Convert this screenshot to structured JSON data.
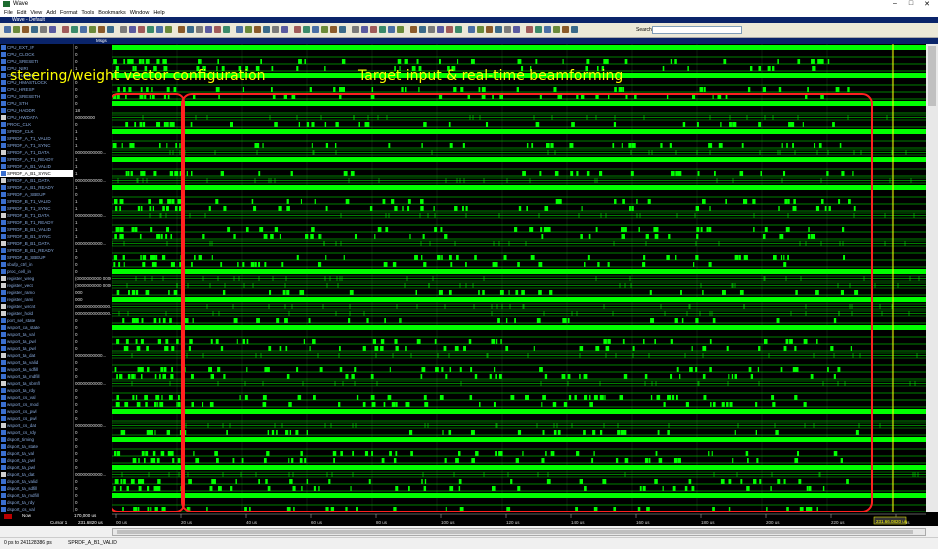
{
  "window": {
    "title": "Wave"
  },
  "menu": [
    "File",
    "Edit",
    "View",
    "Add",
    "Format",
    "Tools",
    "Bookmarks",
    "Window",
    "Help"
  ],
  "subwindow": {
    "title": "Wave - Default"
  },
  "toolbar": {
    "search_label": "Search:",
    "search_value": ""
  },
  "panel_header": {
    "msgs_label": "Msgs"
  },
  "annotations": {
    "left": "steering/weight vector configuration",
    "right": "Target input & real-time beamforming"
  },
  "signals": [
    {
      "name": "CPU_EXT_IF",
      "value": "0"
    },
    {
      "name": "CPU_CLOCK",
      "value": "0"
    },
    {
      "name": "CPU_SRESETI",
      "value": "0"
    },
    {
      "name": "CPU_NIRI",
      "value": "1"
    },
    {
      "name": "CPU_HADDR",
      "value": ""
    },
    {
      "name": "CPU_HMASTLOCK",
      "value": "0"
    },
    {
      "name": "CPU_HRESP",
      "value": "0"
    },
    {
      "name": "CPU_SRESETH",
      "value": "0"
    },
    {
      "name": "CPU_STH",
      "value": "0"
    },
    {
      "name": "CPU_HADDR",
      "value": "18"
    },
    {
      "name": "CPU_HWDATA",
      "value": "00000000"
    },
    {
      "name": "PROC_CLK",
      "value": "0"
    },
    {
      "name": "SPRDF_CLK",
      "value": "1"
    },
    {
      "name": "SPRDF_A_T1_VALID",
      "value": "1"
    },
    {
      "name": "SPRDF_A_T1_SYNC",
      "value": "1"
    },
    {
      "name": "SPRDF_A_T1_DATA",
      "value": "00000000000..."
    },
    {
      "name": "SPRDF_A_T1_READY",
      "value": "1"
    },
    {
      "name": "SPRDF_A_B1_VALID",
      "value": "1"
    },
    {
      "name": "SPRDF_A_B1_SYNC",
      "value": "1"
    },
    {
      "name": "SPRDF_A_B1_DATA",
      "value": "00000000000..."
    },
    {
      "name": "SPRDF_A_B1_READY",
      "value": "1"
    },
    {
      "name": "SPRDF_A_SBEUP",
      "value": "0"
    },
    {
      "name": "SPRDF_B_T1_VALID",
      "value": "1"
    },
    {
      "name": "SPRDF_B_T1_SYNC",
      "value": "1"
    },
    {
      "name": "SPRDF_B_T1_DATA",
      "value": "00000000000..."
    },
    {
      "name": "SPRDF_B_T1_READY",
      "value": "1"
    },
    {
      "name": "SPRDF_B_B1_VALID",
      "value": "1"
    },
    {
      "name": "SPRDF_B_B1_SYNC",
      "value": "1"
    },
    {
      "name": "SPRDF_B_B1_DATA",
      "value": "00000000000..."
    },
    {
      "name": "SPRDF_B_B1_READY",
      "value": "1"
    },
    {
      "name": "SPRDF_B_SBEUP",
      "value": "0"
    },
    {
      "name": "sbufp_ctrl_in",
      "value": "0"
    },
    {
      "name": "proc_cell_in",
      "value": "0"
    },
    {
      "name": "register_wreg",
      "value": "(0000000000 0000..."
    },
    {
      "name": "register_vect",
      "value": "(0000000000 0000..."
    },
    {
      "name": "register_ramo",
      "value": "000"
    },
    {
      "name": "register_rami",
      "value": "000"
    },
    {
      "name": "register_wrcnt",
      "value": "00000000000000..."
    },
    {
      "name": "register_hold",
      "value": "00000000000000..."
    },
    {
      "name": "port_sel_state",
      "value": "0"
    },
    {
      "name": "wsport_ca_state",
      "value": "0"
    },
    {
      "name": "wsport_ta_val",
      "value": "0"
    },
    {
      "name": "wsport_ta_pwl",
      "value": "0"
    },
    {
      "name": "wsport_ta_pwl",
      "value": "0"
    },
    {
      "name": "wsport_ta_dat",
      "value": "00000000000..."
    },
    {
      "name": "wsport_ta_valid",
      "value": "0"
    },
    {
      "name": "wsport_ta_sdfill",
      "value": "0"
    },
    {
      "name": "wsport_ta_mdfill",
      "value": "0"
    },
    {
      "name": "wsport_ta_sbmfl",
      "value": "00000000000..."
    },
    {
      "name": "wsport_ta_rdy",
      "value": "0"
    },
    {
      "name": "wsport_cs_val",
      "value": "0"
    },
    {
      "name": "wsport_cs_mod",
      "value": "0"
    },
    {
      "name": "wsport_cs_pwl",
      "value": "0"
    },
    {
      "name": "wsport_cs_pwl",
      "value": "0"
    },
    {
      "name": "wsport_cs_dat",
      "value": "00000000000..."
    },
    {
      "name": "wsport_cs_rdy",
      "value": "0"
    },
    {
      "name": "dsport_timing",
      "value": "0"
    },
    {
      "name": "dsport_ta_state",
      "value": "0"
    },
    {
      "name": "dsport_ta_val",
      "value": "0"
    },
    {
      "name": "dsport_ta_pwl",
      "value": "0"
    },
    {
      "name": "dsport_ta_pwl",
      "value": "0"
    },
    {
      "name": "dsport_ta_dat",
      "value": "00000000000..."
    },
    {
      "name": "dsport_ta_valid",
      "value": "0"
    },
    {
      "name": "dsport_ta_sdfill",
      "value": "0"
    },
    {
      "name": "dsport_ta_mdfill",
      "value": "0"
    },
    {
      "name": "dsport_ta_rdy",
      "value": "0"
    },
    {
      "name": "dsport_cs_val",
      "value": "0"
    },
    {
      "name": "dsport_cs_mod",
      "value": "0"
    },
    {
      "name": "dsport_cs_pwl",
      "value": "0"
    },
    {
      "name": "dsport_cs_pwl",
      "value": "0"
    },
    {
      "name": "dsport_cs_dat",
      "value": "00000000000..."
    },
    {
      "name": "dsport_cs_rdy",
      "value": "0"
    }
  ],
  "cursor_panel": {
    "now_label": "Now",
    "now_value": "170,000 us",
    "cursor_label": "Cursor 1",
    "cursor_value": "231.6820 us",
    "cursor_flag": "231.66.0820 us"
  },
  "timeline": {
    "ticks": [
      "40 us",
      "60 us",
      "80 us",
      "100 us",
      "120 us",
      "140 us",
      "160 us",
      "180 us",
      "200 us",
      "220 us",
      "240 us"
    ],
    "first_tick": "20 us",
    "origin_label": "00 us"
  },
  "status_bar": {
    "left": "0 ps to 241128386 ps",
    "selected": "SPRDF_A_B1_VALID"
  },
  "colors": {
    "wave": "#00ff00",
    "annotation": "#ffff00",
    "box": "#ff2020",
    "cursor": "#ffff00",
    "name_text": "#88aadd"
  }
}
